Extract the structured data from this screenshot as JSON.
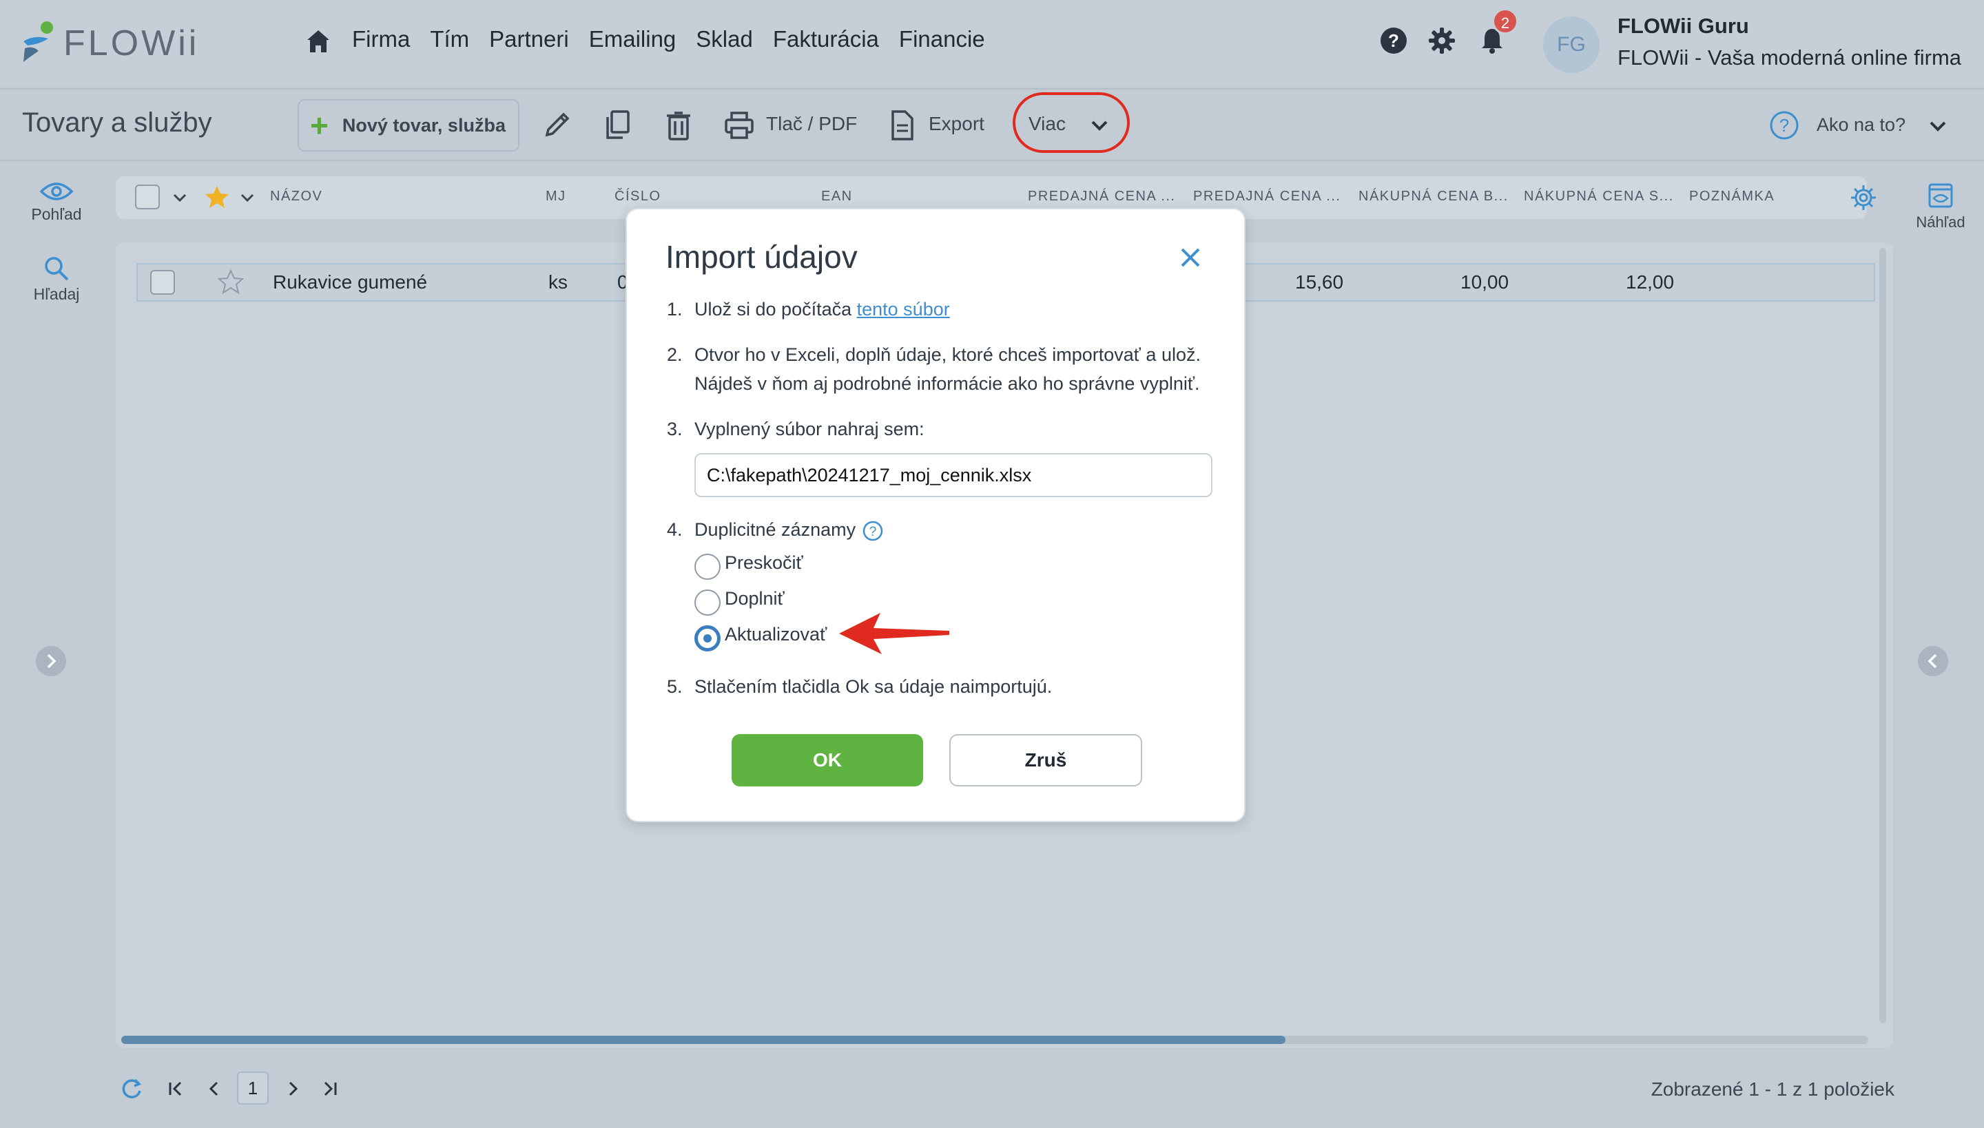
{
  "brand": {
    "name": "FLOWii"
  },
  "nav": {
    "items": [
      "Firma",
      "Tím",
      "Partneri",
      "Emailing",
      "Sklad",
      "Fakturácia",
      "Financie"
    ]
  },
  "header": {
    "notification_count": "2",
    "avatar_initials": "FG",
    "user_name": "FLOWii Guru",
    "company_name": "FLOWii - Vaša moderná online firma"
  },
  "toolbar": {
    "page_title": "Tovary a služby",
    "new_item_label": "Nový tovar, služba",
    "print_label": "Tlač / PDF",
    "export_label": "Export",
    "more_label": "Viac",
    "help_label": "Ako na to?"
  },
  "sidebar": {
    "view_label": "Pohľad",
    "search_label": "Hľadaj"
  },
  "right_panel": {
    "preview_label": "Náhľad"
  },
  "grid": {
    "columns": [
      "NÁZOV",
      "MJ",
      "ČÍSLO",
      "EAN",
      "PREDAJNÁ CENA ...",
      "PREDAJNÁ CENA ...",
      "NÁKUPNÁ CENA B...",
      "NÁKUPNÁ CENA S...",
      "POZNÁMKA"
    ],
    "rows": [
      {
        "name": "Rukavice gumené",
        "unit": "ks",
        "number": "0",
        "sale_price_1": "",
        "sale_price_2": "15,60",
        "purchase_price_1": "10,00",
        "purchase_price_2": "12,00"
      }
    ]
  },
  "footer": {
    "current_page": "1",
    "info": "Zobrazené 1 - 1 z 1 položiek"
  },
  "modal": {
    "title": "Import údajov",
    "step1_num": "1.",
    "step1_text": "Ulož si do počítača ",
    "step1_link": "tento súbor",
    "step2_num": "2.",
    "step2_line1": "Otvor ho v Exceli, doplň údaje, ktoré chceš importovať a ulož.",
    "step2_line2": "Nájdeš v ňom aj podrobné informácie ako ho správne vyplniť.",
    "step3_num": "3.",
    "step3_text": "Vyplnený súbor nahraj sem:",
    "file_value": "C:\\fakepath\\20241217_moj_cennik.xlsx",
    "step4_num": "4.",
    "step4_text": "Duplicitné záznamy",
    "options": [
      "Preskočiť",
      "Doplniť",
      "Aktualizovať"
    ],
    "selected_option": "Aktualizovať",
    "step5_num": "5.",
    "step5_text": "Stlačením tlačidla Ok sa údaje naimportujú.",
    "ok_label": "OK",
    "cancel_label": "Zruš"
  },
  "colors": {
    "accent_green": "#5fb340",
    "accent_blue": "#3a7ebf",
    "highlight_red": "#e02a1f",
    "badge_red": "#d9534f"
  }
}
